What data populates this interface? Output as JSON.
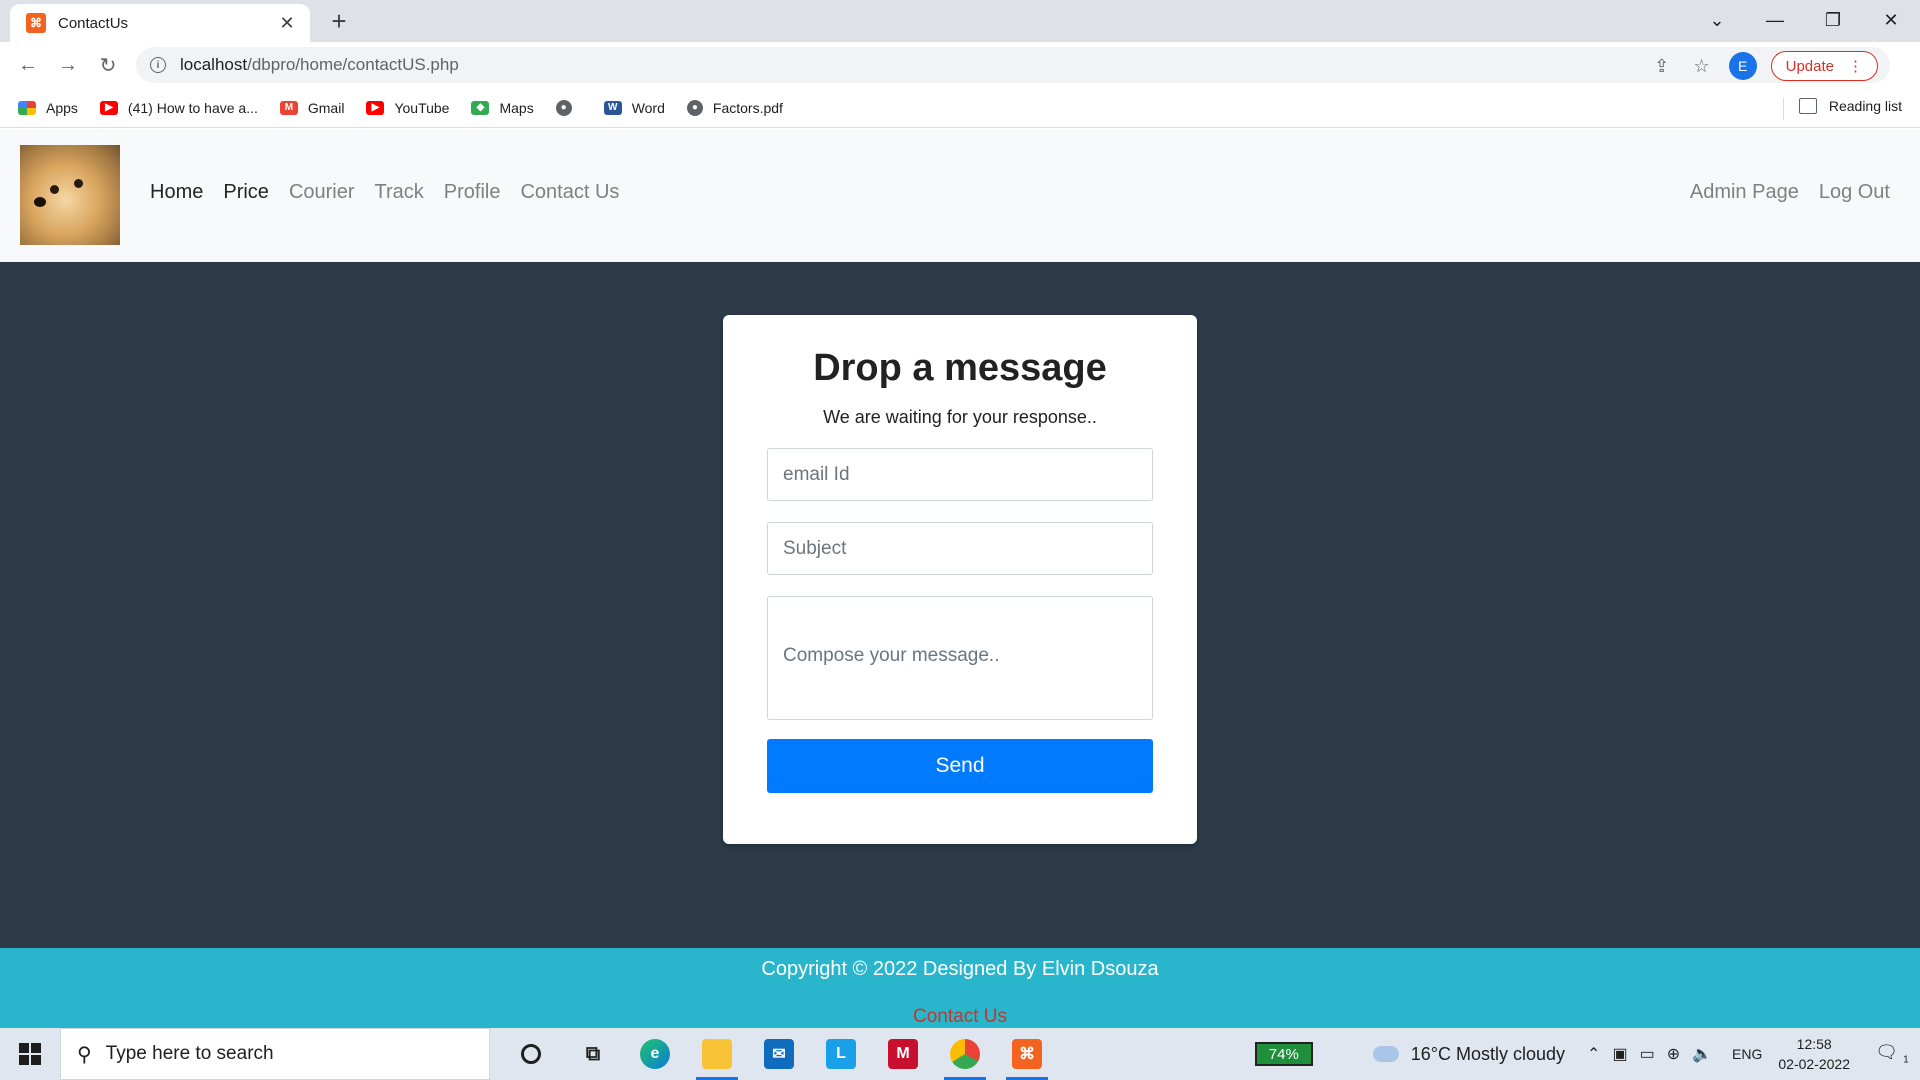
{
  "browser": {
    "tab_title": "ContactUs",
    "tab_close": "✕",
    "new_tab": "+",
    "url_host": "localhost",
    "url_path": "/dbpro/home/contactUS.php",
    "profile_initial": "E",
    "update_label": "Update",
    "bookmarks": [
      {
        "label": "Apps",
        "icon": "apps-grid-icon",
        "color": "#ea4335"
      },
      {
        "label": "(41) How to have a...",
        "icon": "youtube-icon",
        "color": "#ff0000"
      },
      {
        "label": "Gmail",
        "icon": "gmail-icon",
        "color": "#ea4335"
      },
      {
        "label": "YouTube",
        "icon": "youtube-icon",
        "color": "#ff0000"
      },
      {
        "label": "Maps",
        "icon": "maps-icon",
        "color": "#34a853"
      },
      {
        "label": "",
        "icon": "globe-icon",
        "color": "#5f6368"
      },
      {
        "label": "Word",
        "icon": "word-icon",
        "color": "#2b579a"
      },
      {
        "label": "Factors.pdf",
        "icon": "globe-icon",
        "color": "#5f6368"
      }
    ],
    "reading_list": "Reading list"
  },
  "site": {
    "nav": {
      "left": [
        {
          "label": "Home",
          "active": true
        },
        {
          "label": "Price",
          "active": true
        },
        {
          "label": "Courier",
          "active": false
        },
        {
          "label": "Track",
          "active": false
        },
        {
          "label": "Profile",
          "active": false
        },
        {
          "label": "Contact Us",
          "active": false
        }
      ],
      "right": [
        "Admin Page",
        "Log Out"
      ]
    },
    "form": {
      "title": "Drop a message",
      "subtitle": "We are waiting for your response..",
      "email_placeholder": "email Id",
      "subject_placeholder": "Subject",
      "message_placeholder": "Compose your message..",
      "send_label": "Send"
    },
    "footer": {
      "copyright": "Copyright © 2022 Designed By Elvin Dsouza",
      "link": "Contact Us"
    },
    "colors": {
      "main_bg": "#2c3a4a",
      "footer_bg": "#29b6cc",
      "button": "#007bff"
    }
  },
  "taskbar": {
    "search_placeholder": "Type here to search",
    "battery": "74%",
    "weather": "16°C  Mostly cloudy",
    "language": "ENG",
    "time": "12:58",
    "date": "02-02-2022",
    "notification_count": "1"
  }
}
